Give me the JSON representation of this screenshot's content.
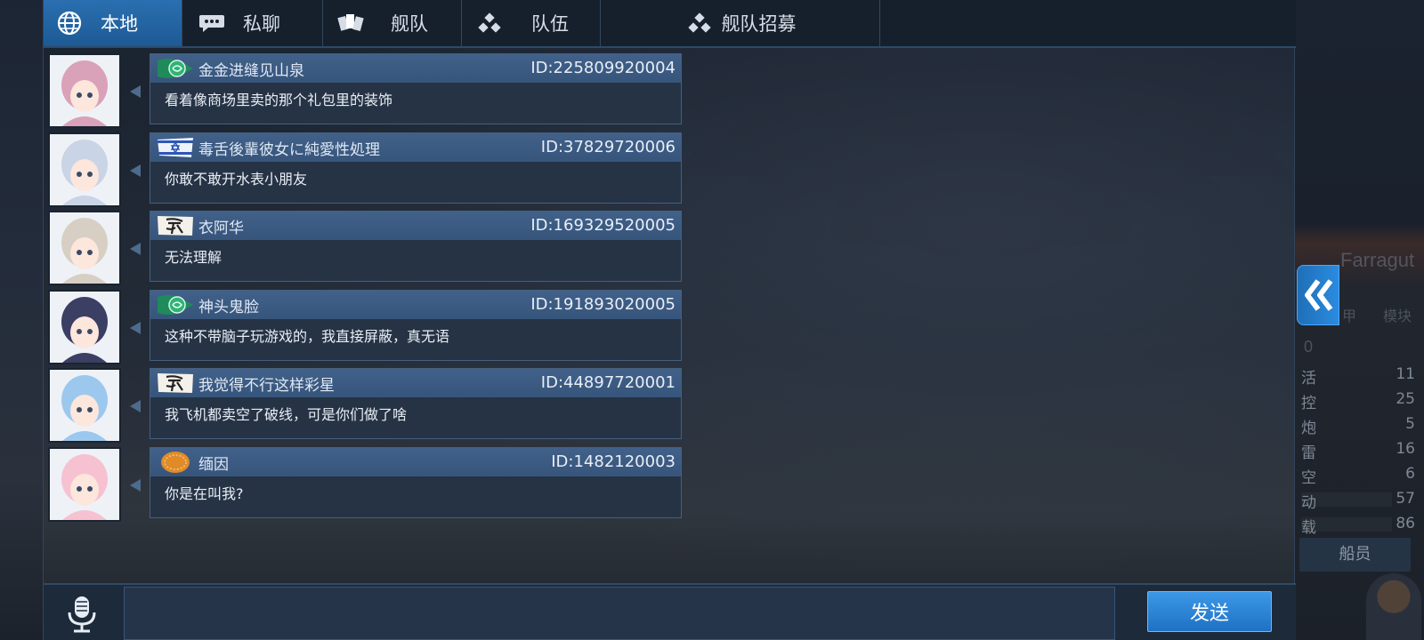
{
  "tabs": [
    {
      "label": "本地",
      "icon": "globe-icon",
      "active": true
    },
    {
      "label": "私聊",
      "icon": "chat-bubble-icon",
      "active": false
    },
    {
      "label": "舰队",
      "icon": "fleet-cards-icon",
      "active": false
    },
    {
      "label": "队伍",
      "icon": "team-dots-icon",
      "active": false
    },
    {
      "label": "舰队招募",
      "icon": "team-dots-icon",
      "active": false
    }
  ],
  "messages": [
    {
      "badge": "green-emblem-badge",
      "name": "金金进缝见山泉",
      "id": "ID:225809920004",
      "text": "看着像商场里卖的那个礼包里的装饰",
      "avatar_color": "#d9a2b8"
    },
    {
      "badge": "star-flag-badge",
      "name": "毒舌後輩彼女に純愛性処理",
      "id": "ID:37829720006",
      "text": "你敢不敢开水表小朋友",
      "avatar_color": "#c9d4e6"
    },
    {
      "badge": "calligraphy-badge",
      "name": "衣阿华",
      "id": "ID:169329520005",
      "text": "无法理解",
      "avatar_color": "#d8cfc4"
    },
    {
      "badge": "green-emblem-badge",
      "name": "神头鬼脸",
      "id": "ID:191893020005",
      "text": "这种不带脑子玩游戏的，我直接屏蔽，真无语",
      "avatar_color": "#3b3f63"
    },
    {
      "badge": "calligraphy-badge",
      "name": "我觉得不行这样彩星",
      "id": "ID:44897720001",
      "text": "我飞机都卖空了破线，可是你们做了啥",
      "avatar_color": "#9cc8ee"
    },
    {
      "badge": "orange-coin-badge",
      "name": "缅因",
      "id": "ID:1482120003",
      "text": "你是在叫我?",
      "avatar_color": "#f6c2d2"
    }
  ],
  "input": {
    "value": "",
    "placeholder": ""
  },
  "send_label": "发送",
  "background_peek": {
    "ship_name": "Farragut",
    "tab_labels": [
      "甲",
      "模块"
    ],
    "zero_label": "0",
    "stat_labels": [
      "活",
      "控",
      "炮",
      "雷",
      "空",
      "动",
      "载"
    ],
    "stat_values": [
      "11",
      "25",
      "5",
      "16",
      "6",
      "57",
      "86"
    ],
    "crew_label": "船员"
  },
  "colors": {
    "tab_active": "#2a6fb0",
    "bubble_header": "#41618a",
    "bubble_body": "#253345",
    "send_button": "#2b84d6"
  }
}
